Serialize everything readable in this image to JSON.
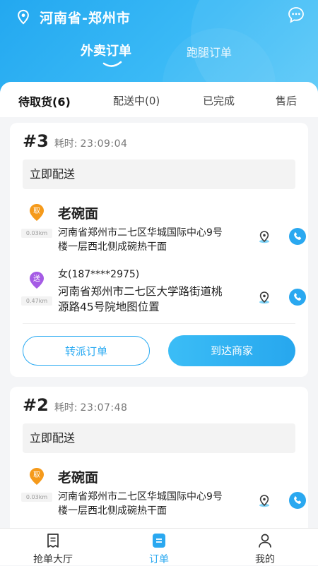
{
  "header": {
    "location": "河南省-郑州市",
    "tabs": [
      {
        "label": "外卖订单",
        "active": true
      },
      {
        "label": "跑腿订单",
        "active": false
      }
    ],
    "accent_color": "#2aa8f0",
    "icons": {
      "location": "location-pin-icon",
      "chat": "chat-bubble-icon"
    }
  },
  "sub_tabs": [
    {
      "label": "待取货(6)",
      "active": true
    },
    {
      "label": "配送中(0)",
      "active": false
    },
    {
      "label": "已完成",
      "active": false
    },
    {
      "label": "售后",
      "active": false
    }
  ],
  "orders": [
    {
      "number": "#3",
      "elapsed_label": "耗时:",
      "elapsed_value": "23:09:04",
      "delivery_type": "立即配送",
      "pickup": {
        "badge": "取",
        "distance": "0.03km",
        "name": "老碗面",
        "address": "河南省郑州市二七区华城国际中心9号楼一层西北侧成碗热干面"
      },
      "dropoff": {
        "badge": "送",
        "distance": "0.47km",
        "person": "女(187****2975)",
        "address": "河南省郑州市二七区大学路街道桃源路45号院地图位置"
      },
      "buttons": {
        "transfer": "转派订单",
        "arrive": "到达商家"
      }
    },
    {
      "number": "#2",
      "elapsed_label": "耗时:",
      "elapsed_value": "23:07:48",
      "delivery_type": "立即配送",
      "pickup": {
        "badge": "取",
        "distance": "0.03km",
        "name": "老碗面",
        "address": "河南省郑州市二七区华城国际中心9号楼一层西北侧成碗热干面"
      }
    }
  ],
  "bottom_nav": [
    {
      "label": "抢单大厅",
      "icon": "order-hall-icon",
      "active": false
    },
    {
      "label": "订单",
      "icon": "orders-icon",
      "active": true
    },
    {
      "label": "我的",
      "icon": "profile-icon",
      "active": false
    }
  ]
}
